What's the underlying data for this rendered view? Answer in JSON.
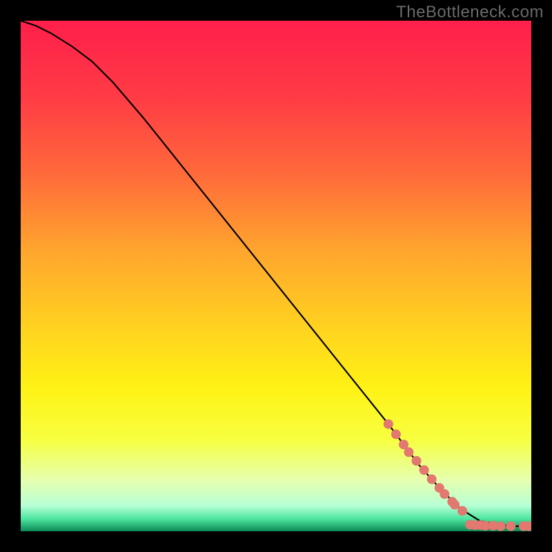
{
  "watermark": "TheBottleneck.com",
  "chart_data": {
    "type": "line",
    "title": "",
    "xlabel": "",
    "ylabel": "",
    "xlim": [
      0,
      100
    ],
    "ylim": [
      0,
      100
    ],
    "grid": false,
    "legend": false,
    "background_gradient": {
      "stops": [
        {
          "offset": 0.0,
          "color": "#ff1f4b"
        },
        {
          "offset": 0.15,
          "color": "#ff3b45"
        },
        {
          "offset": 0.3,
          "color": "#ff6a3a"
        },
        {
          "offset": 0.45,
          "color": "#ffa52e"
        },
        {
          "offset": 0.6,
          "color": "#ffd21f"
        },
        {
          "offset": 0.72,
          "color": "#fff215"
        },
        {
          "offset": 0.82,
          "color": "#f7ff40"
        },
        {
          "offset": 0.9,
          "color": "#e6ffb0"
        },
        {
          "offset": 0.95,
          "color": "#b6ffd4"
        },
        {
          "offset": 0.975,
          "color": "#4fe6a0"
        },
        {
          "offset": 1.0,
          "color": "#0c8a56"
        }
      ]
    },
    "series": [
      {
        "name": "curve",
        "color": "#000000",
        "x": [
          0,
          3,
          6,
          10,
          14,
          18,
          24,
          30,
          36,
          42,
          48,
          54,
          60,
          66,
          72,
          78,
          82,
          86,
          90,
          94,
          97,
          100
        ],
        "y": [
          100,
          99,
          97.5,
          95,
          92,
          88,
          81,
          73.5,
          66,
          58.5,
          51,
          43.5,
          36,
          28.5,
          21,
          13,
          8.5,
          4.5,
          2,
          1.2,
          1,
          1
        ]
      }
    ],
    "markers": {
      "comment": "Coral/salmon sample points along the lower-right portion of the curve and along the floor",
      "color": "#e2786f",
      "radius_px": 7,
      "points": [
        {
          "x": 72,
          "y": 21
        },
        {
          "x": 73.5,
          "y": 19
        },
        {
          "x": 75,
          "y": 17
        },
        {
          "x": 76,
          "y": 15.5
        },
        {
          "x": 77.5,
          "y": 13.8
        },
        {
          "x": 79,
          "y": 12
        },
        {
          "x": 80.5,
          "y": 10.2
        },
        {
          "x": 82,
          "y": 8.5
        },
        {
          "x": 83,
          "y": 7.3
        },
        {
          "x": 84.5,
          "y": 5.8
        },
        {
          "x": 85,
          "y": 5.2
        },
        {
          "x": 86.5,
          "y": 4
        },
        {
          "x": 88,
          "y": 1.3
        },
        {
          "x": 89,
          "y": 1.2
        },
        {
          "x": 90,
          "y": 1.2
        },
        {
          "x": 91,
          "y": 1.1
        },
        {
          "x": 92.5,
          "y": 1.1
        },
        {
          "x": 94,
          "y": 1
        },
        {
          "x": 96,
          "y": 1
        },
        {
          "x": 98.5,
          "y": 1
        },
        {
          "x": 99.5,
          "y": 1
        }
      ]
    }
  }
}
